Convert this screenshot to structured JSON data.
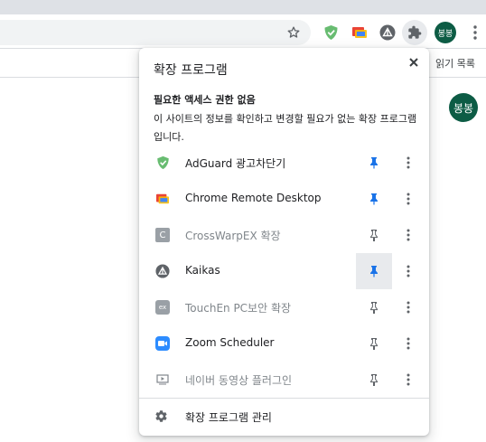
{
  "browser": {
    "bookmarks_partial": "읽기 목록",
    "avatar_text": "봉봉",
    "page_avatar_text": "봉봉"
  },
  "popup": {
    "title": "확장 프로그램",
    "section_heading": "필요한 액세스 권한 없음",
    "section_description": "이 사이트의 정보를 확인하고 변경할 필요가 없는 확장 프로그램입니다.",
    "extensions": [
      {
        "name": "AdGuard 광고차단기",
        "icon": "adguard-shield-icon",
        "pinned": true,
        "enabled": true
      },
      {
        "name": "Chrome Remote Desktop",
        "icon": "chrome-remote-desktop-icon",
        "pinned": true,
        "enabled": true
      },
      {
        "name": "CrossWarpEX 확장",
        "icon": "crosswarpex-icon",
        "icon_text": "C",
        "pinned": false,
        "enabled": false
      },
      {
        "name": "Kaikas",
        "icon": "kaikas-icon",
        "pinned": true,
        "enabled": true
      },
      {
        "name": "TouchEn PC보안 확장",
        "icon": "touchen-icon",
        "icon_text": "ex",
        "pinned": false,
        "enabled": false
      },
      {
        "name": "Zoom Scheduler",
        "icon": "zoom-icon",
        "pinned": false,
        "enabled": true
      },
      {
        "name": "네이버 동영상 플러그인",
        "icon": "naver-video-icon",
        "pinned": false,
        "enabled": false
      }
    ],
    "manage_label": "확장 프로그램 관리"
  },
  "colors": {
    "pin_active": "#1a73e8",
    "pin_inactive": "#5f6368",
    "avatar_bg": "#0d5c45",
    "adguard": "#68bc71",
    "zoom": "#2d8cff",
    "text_enabled": "#202124",
    "text_disabled": "#80868b"
  }
}
